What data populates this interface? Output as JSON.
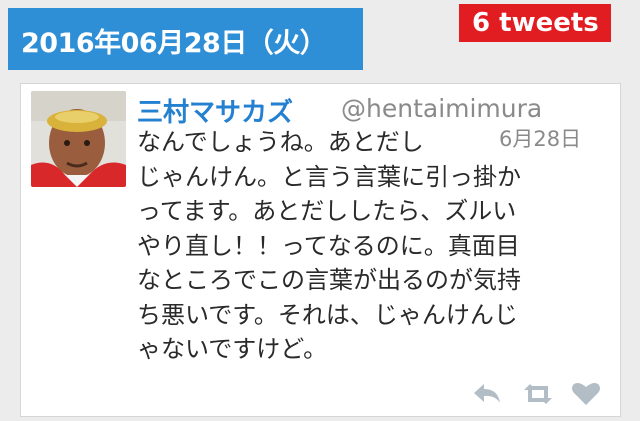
{
  "header": {
    "date": "2016年06月28日（火）",
    "count_badge": "6 tweets"
  },
  "tweet": {
    "author_name": "三村マサカズ",
    "author_handle": "@hentaimimura",
    "date": "6月28日",
    "body": "なんでしょうね。あとだし\nじゃんけん。と言う言葉に引っ掛か\nってます。あとだししたら、ズルい\nやり直し！！ってなるのに。真面目\nなところでこの言葉が出るのが気持\nち悪いです。それは、じゃんけんじ\nゃないですけど。",
    "actions": [
      "reply-icon",
      "retweet-icon",
      "favorite-icon"
    ]
  },
  "colors": {
    "header_bg": "#2e8fd6",
    "badge_bg": "#e11d22",
    "name": "#2480d0",
    "muted": "#8a8a8a",
    "icon": "#b2bdc6"
  }
}
